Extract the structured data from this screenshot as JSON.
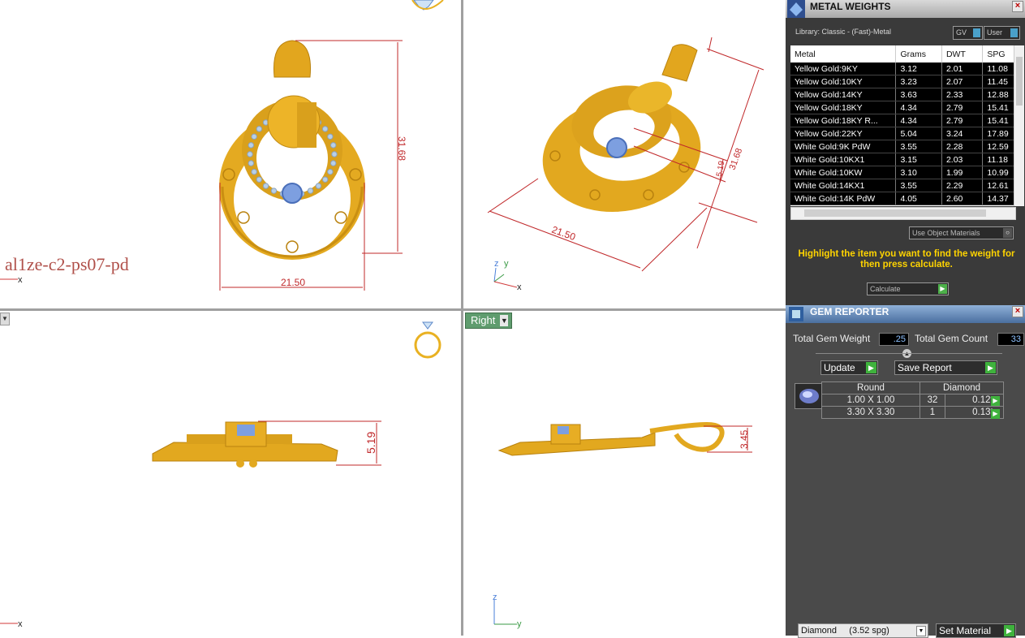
{
  "viewports": {
    "top": {
      "title": "al1ze-c2-ps07-pd",
      "dim_height": "31.68",
      "dim_width": "21.50",
      "axis_x": "x"
    },
    "perspective": {
      "dim_width": "21.50",
      "dim_height": "31.68",
      "dim_small": "5.19",
      "axis_z": "z",
      "axis_y": "y",
      "axis_x": "x"
    },
    "front": {
      "dim": "5.19",
      "axis_x": "x"
    },
    "right": {
      "tab_label": "Right",
      "dim": "3.45",
      "axis_z": "z",
      "axis_y": "y"
    }
  },
  "metal_weights": {
    "title": "METAL WEIGHTS",
    "library": "Library: Classic - (Fast)-Metal",
    "toggle_gv": "GV",
    "toggle_user": "User",
    "columns": [
      "Metal",
      "Grams",
      "DWT",
      "SPG"
    ],
    "rows": [
      [
        "Yellow Gold:9KY",
        "3.12",
        "2.01",
        "11.08"
      ],
      [
        "Yellow Gold:10KY",
        "3.23",
        "2.07",
        "11.45"
      ],
      [
        "Yellow Gold:14KY",
        "3.63",
        "2.33",
        "12.88"
      ],
      [
        "Yellow Gold:18KY",
        "4.34",
        "2.79",
        "15.41"
      ],
      [
        "Yellow Gold:18KY R...",
        "4.34",
        "2.79",
        "15.41"
      ],
      [
        "Yellow Gold:22KY",
        "5.04",
        "3.24",
        "17.89"
      ],
      [
        "White Gold:9K PdW",
        "3.55",
        "2.28",
        "12.59"
      ],
      [
        "White Gold:10KX1",
        "3.15",
        "2.03",
        "11.18"
      ],
      [
        "White Gold:10KW",
        "3.10",
        "1.99",
        "10.99"
      ],
      [
        "White Gold:14KX1",
        "3.55",
        "2.29",
        "12.61"
      ],
      [
        "White Gold:14K PdW",
        "4.05",
        "2.60",
        "14.37"
      ]
    ],
    "use_object_materials": "Use Object Materials",
    "hint": "Highlight the item you want to find the weight for then press calculate.",
    "calculate": "Calculate"
  },
  "gem_reporter": {
    "title": "GEM REPORTER",
    "total_weight_label": "Total Gem Weight",
    "total_weight_value": ".25",
    "total_count_label": "Total Gem Count",
    "total_count_value": "33",
    "update": "Update",
    "save_report": "Save Report",
    "header_shape": "Round",
    "header_material": "Diamond",
    "gems": [
      {
        "size": "1.00 X 1.00",
        "count": "32",
        "weight": "0.12tw"
      },
      {
        "size": "3.30 X 3.30",
        "count": "1",
        "weight": "0.13tw"
      }
    ],
    "material_select": "Diamond     (3.52 spg)",
    "set_material": "Set Material"
  },
  "colors": {
    "gold": "#e9b122",
    "gold_dark": "#b9820f",
    "gem_blue": "#7d9fe0",
    "dim_red": "#c0282a",
    "panel_bg": "#3a3a3a",
    "hint_yellow": "#ffd400",
    "button_green": "#3fb23d"
  }
}
